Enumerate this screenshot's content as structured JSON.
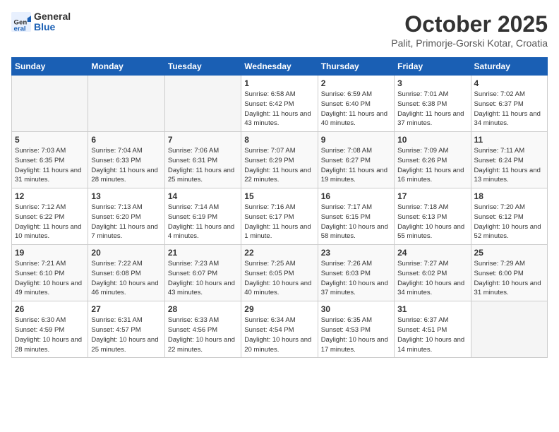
{
  "header": {
    "logo_general": "General",
    "logo_blue": "Blue",
    "month_title": "October 2025",
    "location": "Palit, Primorje-Gorski Kotar, Croatia"
  },
  "weekdays": [
    "Sunday",
    "Monday",
    "Tuesday",
    "Wednesday",
    "Thursday",
    "Friday",
    "Saturday"
  ],
  "weeks": [
    [
      {
        "day": "",
        "sunrise": "",
        "sunset": "",
        "daylight": ""
      },
      {
        "day": "",
        "sunrise": "",
        "sunset": "",
        "daylight": ""
      },
      {
        "day": "",
        "sunrise": "",
        "sunset": "",
        "daylight": ""
      },
      {
        "day": "1",
        "sunrise": "Sunrise: 6:58 AM",
        "sunset": "Sunset: 6:42 PM",
        "daylight": "Daylight: 11 hours and 43 minutes."
      },
      {
        "day": "2",
        "sunrise": "Sunrise: 6:59 AM",
        "sunset": "Sunset: 6:40 PM",
        "daylight": "Daylight: 11 hours and 40 minutes."
      },
      {
        "day": "3",
        "sunrise": "Sunrise: 7:01 AM",
        "sunset": "Sunset: 6:38 PM",
        "daylight": "Daylight: 11 hours and 37 minutes."
      },
      {
        "day": "4",
        "sunrise": "Sunrise: 7:02 AM",
        "sunset": "Sunset: 6:37 PM",
        "daylight": "Daylight: 11 hours and 34 minutes."
      }
    ],
    [
      {
        "day": "5",
        "sunrise": "Sunrise: 7:03 AM",
        "sunset": "Sunset: 6:35 PM",
        "daylight": "Daylight: 11 hours and 31 minutes."
      },
      {
        "day": "6",
        "sunrise": "Sunrise: 7:04 AM",
        "sunset": "Sunset: 6:33 PM",
        "daylight": "Daylight: 11 hours and 28 minutes."
      },
      {
        "day": "7",
        "sunrise": "Sunrise: 7:06 AM",
        "sunset": "Sunset: 6:31 PM",
        "daylight": "Daylight: 11 hours and 25 minutes."
      },
      {
        "day": "8",
        "sunrise": "Sunrise: 7:07 AM",
        "sunset": "Sunset: 6:29 PM",
        "daylight": "Daylight: 11 hours and 22 minutes."
      },
      {
        "day": "9",
        "sunrise": "Sunrise: 7:08 AM",
        "sunset": "Sunset: 6:27 PM",
        "daylight": "Daylight: 11 hours and 19 minutes."
      },
      {
        "day": "10",
        "sunrise": "Sunrise: 7:09 AM",
        "sunset": "Sunset: 6:26 PM",
        "daylight": "Daylight: 11 hours and 16 minutes."
      },
      {
        "day": "11",
        "sunrise": "Sunrise: 7:11 AM",
        "sunset": "Sunset: 6:24 PM",
        "daylight": "Daylight: 11 hours and 13 minutes."
      }
    ],
    [
      {
        "day": "12",
        "sunrise": "Sunrise: 7:12 AM",
        "sunset": "Sunset: 6:22 PM",
        "daylight": "Daylight: 11 hours and 10 minutes."
      },
      {
        "day": "13",
        "sunrise": "Sunrise: 7:13 AM",
        "sunset": "Sunset: 6:20 PM",
        "daylight": "Daylight: 11 hours and 7 minutes."
      },
      {
        "day": "14",
        "sunrise": "Sunrise: 7:14 AM",
        "sunset": "Sunset: 6:19 PM",
        "daylight": "Daylight: 11 hours and 4 minutes."
      },
      {
        "day": "15",
        "sunrise": "Sunrise: 7:16 AM",
        "sunset": "Sunset: 6:17 PM",
        "daylight": "Daylight: 11 hours and 1 minute."
      },
      {
        "day": "16",
        "sunrise": "Sunrise: 7:17 AM",
        "sunset": "Sunset: 6:15 PM",
        "daylight": "Daylight: 10 hours and 58 minutes."
      },
      {
        "day": "17",
        "sunrise": "Sunrise: 7:18 AM",
        "sunset": "Sunset: 6:13 PM",
        "daylight": "Daylight: 10 hours and 55 minutes."
      },
      {
        "day": "18",
        "sunrise": "Sunrise: 7:20 AM",
        "sunset": "Sunset: 6:12 PM",
        "daylight": "Daylight: 10 hours and 52 minutes."
      }
    ],
    [
      {
        "day": "19",
        "sunrise": "Sunrise: 7:21 AM",
        "sunset": "Sunset: 6:10 PM",
        "daylight": "Daylight: 10 hours and 49 minutes."
      },
      {
        "day": "20",
        "sunrise": "Sunrise: 7:22 AM",
        "sunset": "Sunset: 6:08 PM",
        "daylight": "Daylight: 10 hours and 46 minutes."
      },
      {
        "day": "21",
        "sunrise": "Sunrise: 7:23 AM",
        "sunset": "Sunset: 6:07 PM",
        "daylight": "Daylight: 10 hours and 43 minutes."
      },
      {
        "day": "22",
        "sunrise": "Sunrise: 7:25 AM",
        "sunset": "Sunset: 6:05 PM",
        "daylight": "Daylight: 10 hours and 40 minutes."
      },
      {
        "day": "23",
        "sunrise": "Sunrise: 7:26 AM",
        "sunset": "Sunset: 6:03 PM",
        "daylight": "Daylight: 10 hours and 37 minutes."
      },
      {
        "day": "24",
        "sunrise": "Sunrise: 7:27 AM",
        "sunset": "Sunset: 6:02 PM",
        "daylight": "Daylight: 10 hours and 34 minutes."
      },
      {
        "day": "25",
        "sunrise": "Sunrise: 7:29 AM",
        "sunset": "Sunset: 6:00 PM",
        "daylight": "Daylight: 10 hours and 31 minutes."
      }
    ],
    [
      {
        "day": "26",
        "sunrise": "Sunrise: 6:30 AM",
        "sunset": "Sunset: 4:59 PM",
        "daylight": "Daylight: 10 hours and 28 minutes."
      },
      {
        "day": "27",
        "sunrise": "Sunrise: 6:31 AM",
        "sunset": "Sunset: 4:57 PM",
        "daylight": "Daylight: 10 hours and 25 minutes."
      },
      {
        "day": "28",
        "sunrise": "Sunrise: 6:33 AM",
        "sunset": "Sunset: 4:56 PM",
        "daylight": "Daylight: 10 hours and 22 minutes."
      },
      {
        "day": "29",
        "sunrise": "Sunrise: 6:34 AM",
        "sunset": "Sunset: 4:54 PM",
        "daylight": "Daylight: 10 hours and 20 minutes."
      },
      {
        "day": "30",
        "sunrise": "Sunrise: 6:35 AM",
        "sunset": "Sunset: 4:53 PM",
        "daylight": "Daylight: 10 hours and 17 minutes."
      },
      {
        "day": "31",
        "sunrise": "Sunrise: 6:37 AM",
        "sunset": "Sunset: 4:51 PM",
        "daylight": "Daylight: 10 hours and 14 minutes."
      },
      {
        "day": "",
        "sunrise": "",
        "sunset": "",
        "daylight": ""
      }
    ]
  ]
}
